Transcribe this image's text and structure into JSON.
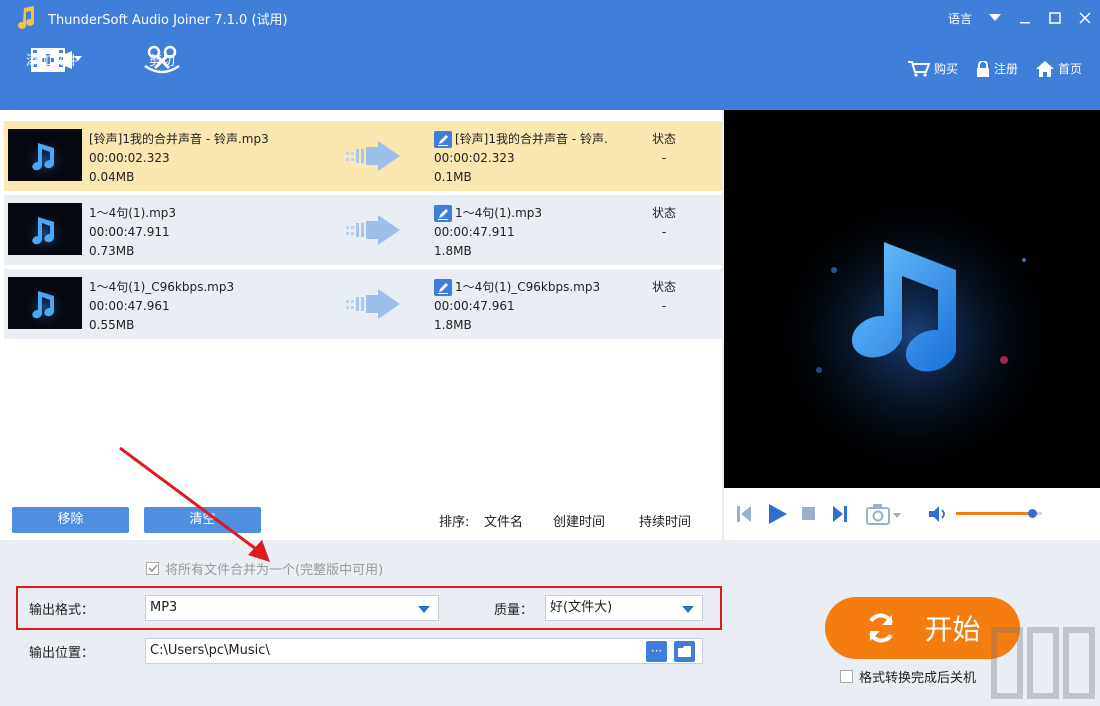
{
  "titlebar": {
    "title": "ThunderSoft Audio Joiner 7.1.0 (试用)",
    "language": "语言"
  },
  "toolbar": {
    "add_file": "添加文件",
    "cut": "剪切",
    "buy": "购买",
    "register": "注册",
    "home": "首页"
  },
  "files": [
    {
      "name": "[铃声]1我的合并声音 - 铃声.mp3",
      "duration": "00:00:02.323",
      "size": "0.04MB",
      "out_name": "[铃声]1我的合并声音 - 铃声.",
      "out_duration": "00:00:02.323",
      "out_size": "0.1MB",
      "status_label": "状态",
      "status_value": "-",
      "selected": true
    },
    {
      "name": "1～4句(1).mp3",
      "duration": "00:00:47.911",
      "size": "0.73MB",
      "out_name": "1～4句(1).mp3",
      "out_duration": "00:00:47.911",
      "out_size": "1.8MB",
      "status_label": "状态",
      "status_value": "-",
      "selected": false
    },
    {
      "name": "1～4句(1)_C96kbps.mp3",
      "duration": "00:00:47.961",
      "size": "0.55MB",
      "out_name": "1～4句(1)_C96kbps.mp3",
      "out_duration": "00:00:47.961",
      "out_size": "1.8MB",
      "status_label": "状态",
      "status_value": "-",
      "selected": false
    }
  ],
  "list_actions": {
    "remove": "移除",
    "clear": "清空"
  },
  "sort": {
    "label": "排序:",
    "by_name": "文件名",
    "by_created": "创建时间",
    "by_duration": "持续时间"
  },
  "player": {
    "volume_level": 0.88
  },
  "options": {
    "merge_all": "将所有文件合并为一个(完整版中可用)",
    "format_label": "输出格式：",
    "format_value": "MP3",
    "quality_label": "质量：",
    "quality_value": "好(文件大)",
    "location_label": "输出位置：",
    "location_value": "C:\\Users\\pc\\Music\\",
    "browse_dots": "···"
  },
  "start": {
    "label": "开始",
    "shutdown": "格式转换完成后关机"
  },
  "colors": {
    "accent": "#3f7fd9",
    "start": "#f57d0f",
    "selected_row": "#fbe7b0",
    "highlight": "#e0191f"
  }
}
